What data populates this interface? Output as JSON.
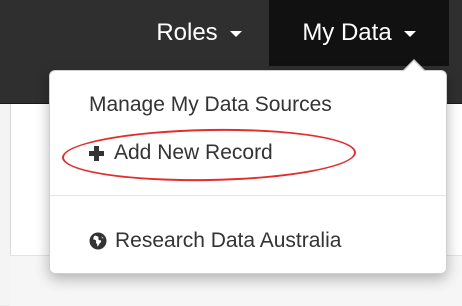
{
  "navbar": {
    "roles_label": "Roles",
    "mydata_label": "My Data"
  },
  "dropdown": {
    "items": [
      {
        "label": "Manage My Data Sources"
      },
      {
        "label": "Add New Record",
        "icon": "plus-icon"
      },
      {
        "label": "Research Data Australia",
        "icon": "globe-icon"
      }
    ]
  },
  "colors": {
    "navbar_bg": "#2f2f2f",
    "active_nav_bg": "#111111",
    "dropdown_text": "#333333",
    "highlight": "#e12f2f"
  }
}
